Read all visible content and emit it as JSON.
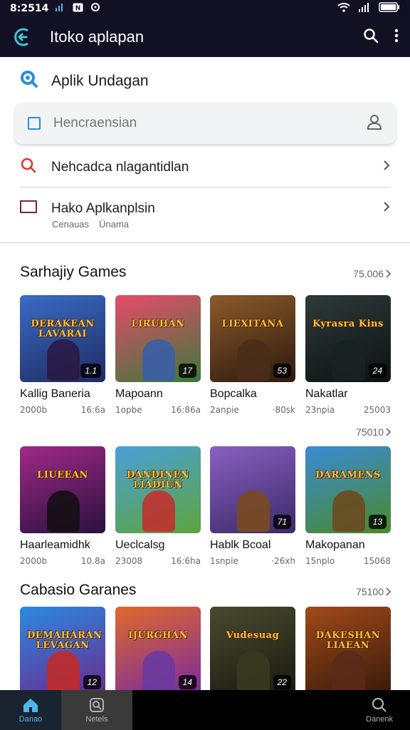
{
  "status_bar": {
    "time": "8:2514",
    "icons": [
      "signal-icon",
      "notification-icon",
      "wifi-icon",
      "battery-icon"
    ]
  },
  "app_bar": {
    "title": "Itoko aplapan"
  },
  "search": {
    "header_label": "Aplik  Undagan",
    "placeholder": "Hencraensian",
    "row1_label": "Nehcadca nlagantidlan",
    "row2_label": "Hako Aplkanplsin",
    "row2_sub1": "Cenauas",
    "row2_sub2": "Ünama"
  },
  "sections": [
    {
      "title": "Sarhajiy Games",
      "see_all_top": "75.006",
      "see_all_bottom": "75010",
      "games": [
        {
          "banner": "DERAKEAN LAVARAI",
          "name": "Kallig Baneria",
          "meta1": "2000b",
          "meta2": "16:6a",
          "badge": "1.1",
          "bg": "#3a6cc5",
          "bg2": "#1e2b63",
          "fig": "#2a1a45"
        },
        {
          "banner": "LIRUHAN",
          "name": "Mapoann",
          "meta1": "1opbe",
          "meta2": "16:86a",
          "badge": "17",
          "bg": "#e84a6a",
          "bg2": "#3a7a3a",
          "fig": "#3b5ea8"
        },
        {
          "banner": "LIEXITANA",
          "name": "Bopcalka",
          "meta1": "2anpie",
          "meta2": "·80sk",
          "badge": "53",
          "bg": "#8b5a2b",
          "bg2": "#2d1a0e",
          "fig": "#4a2e1a"
        },
        {
          "banner": "Kyrasra Kins",
          "name": "Nakatlar",
          "meta1": "23npia",
          "meta2": "25003",
          "badge": "24",
          "bg": "#2e3a3a",
          "bg2": "#0c1212",
          "fig": "#1a2222"
        },
        {
          "banner": "LIUEEAN",
          "name": "Haarleamidhk",
          "meta1": "2000b",
          "meta2": "10.8a",
          "badge": "",
          "bg": "#a02a86",
          "bg2": "#2a1040",
          "fig": "#141014"
        },
        {
          "banner": "DANDINEN LIADIUN",
          "name": "Ueclcalsg",
          "meta1": "23008",
          "meta2": "16:6ha",
          "badge": "",
          "bg": "#4aa0d8",
          "bg2": "#5ca43c",
          "fig": "#c23030"
        },
        {
          "banner": "",
          "name": "Hablk Bcoal",
          "meta1": "1snpie",
          "meta2": "·26xh",
          "badge": "71",
          "bg": "#8a5fc0",
          "bg2": "#3a2a6a",
          "fig": "#7a4a20"
        },
        {
          "banner": "DARAMENS",
          "name": "Makopanan",
          "meta1": "15nplo",
          "meta2": "15068",
          "badge": "13",
          "bg": "#3a8ad6",
          "bg2": "#4a8a2a",
          "fig": "#6a4a20"
        }
      ]
    },
    {
      "title": "Cabasio Garanes",
      "see_all_top": "75100",
      "games": [
        {
          "banner": "DEMAHARAN LEVAGAN",
          "name": "",
          "meta1": "",
          "meta2": "",
          "badge": "12",
          "bg": "#2a8ae0",
          "bg2": "#6a2a90",
          "fig": "#c02a2a"
        },
        {
          "banner": "IJURGHAN",
          "name": "",
          "meta1": "",
          "meta2": "",
          "badge": "14",
          "bg": "#e0692a",
          "bg2": "#7a2aa0",
          "fig": "#6a3aa0"
        },
        {
          "banner": "Vudesuag",
          "name": "",
          "meta1": "",
          "meta2": "",
          "badge": "22",
          "bg": "#4a4a30",
          "bg2": "#1a1a10",
          "fig": "#3a3a20"
        },
        {
          "banner": "DAKESHAN LIAEAN",
          "name": "",
          "meta1": "",
          "meta2": "",
          "badge": "",
          "bg": "#a04a1a",
          "bg2": "#3a1a0a",
          "fig": "#5a2a1a"
        }
      ]
    }
  ],
  "bottom_nav": [
    {
      "label": "Danao",
      "icon": "home-icon",
      "active": true
    },
    {
      "label": "Netels",
      "icon": "bookmark-icon",
      "active": false
    },
    {
      "label": "Danenk",
      "icon": "search-icon",
      "active": false
    }
  ]
}
